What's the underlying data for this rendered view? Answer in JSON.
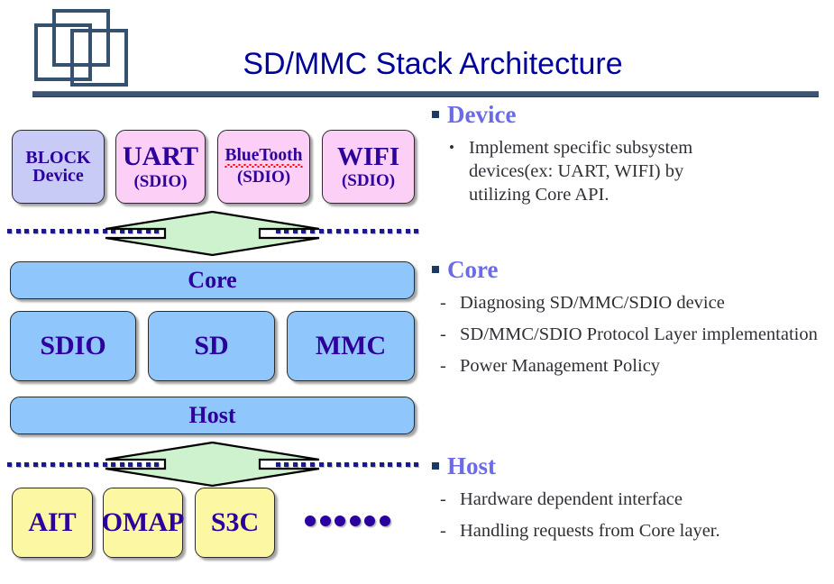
{
  "header": {
    "title": "SD/MMC Stack Architecture",
    "logo_name": "overlapping-squares-logo",
    "rule_color": "#3a5576",
    "title_color": "#00009b"
  },
  "diagram": {
    "device_row": [
      {
        "line1": "BLOCK",
        "line2": "Device",
        "fill": "#c9cbf7",
        "misspelled": false
      },
      {
        "line1": "UART",
        "line2": "(SDIO)",
        "fill": "#fbcff6",
        "misspelled": false
      },
      {
        "line1": "BlueTooth",
        "line2": "(SDIO)",
        "fill": "#fbcff6",
        "misspelled": true
      },
      {
        "line1": "WIFI",
        "line2": "(SDIO)",
        "fill": "#fbcff6",
        "misspelled": false
      }
    ],
    "core_layer": {
      "label": "Core",
      "fill": "#8fc6fb"
    },
    "protocol_row": [
      {
        "label": "SDIO",
        "fill": "#8fc6fb"
      },
      {
        "label": "SD",
        "fill": "#8fc6fb"
      },
      {
        "label": "MMC",
        "fill": "#8fc6fb"
      }
    ],
    "host_layer": {
      "label": "Host",
      "fill": "#8fc6fb"
    },
    "vendor_row": [
      {
        "label": "AIT",
        "fill": "#fbf7a3"
      },
      {
        "label": "OMAP",
        "fill": "#fbf7a3"
      },
      {
        "label": "S3C",
        "fill": "#fbf7a3"
      }
    ],
    "ellipsis_dots": 6,
    "arrow_fill": "#cdf2cd",
    "boundary_dot_color": "#1a1a8f",
    "box_text_color": "#2d009b"
  },
  "panel": {
    "sections": [
      {
        "heading": "Device",
        "marker": "round",
        "bullets": [
          "Implement specific subsystem devices(ex: UART, WIFI) by utilizing Core API."
        ]
      },
      {
        "heading": "Core",
        "marker": "dash",
        "bullets": [
          "Diagnosing SD/MMC/SDIO device",
          "SD/MMC/SDIO Protocol Layer implementation",
          "Power Management Policy"
        ]
      },
      {
        "heading": "Host",
        "marker": "dash",
        "bullets": [
          "Hardware dependent interface",
          "Handling requests from Core layer."
        ]
      }
    ],
    "heading_color": "#6b6be8",
    "bullet_square_color": "#1b3a63",
    "dash_marker": "-",
    "round_marker": "•"
  }
}
